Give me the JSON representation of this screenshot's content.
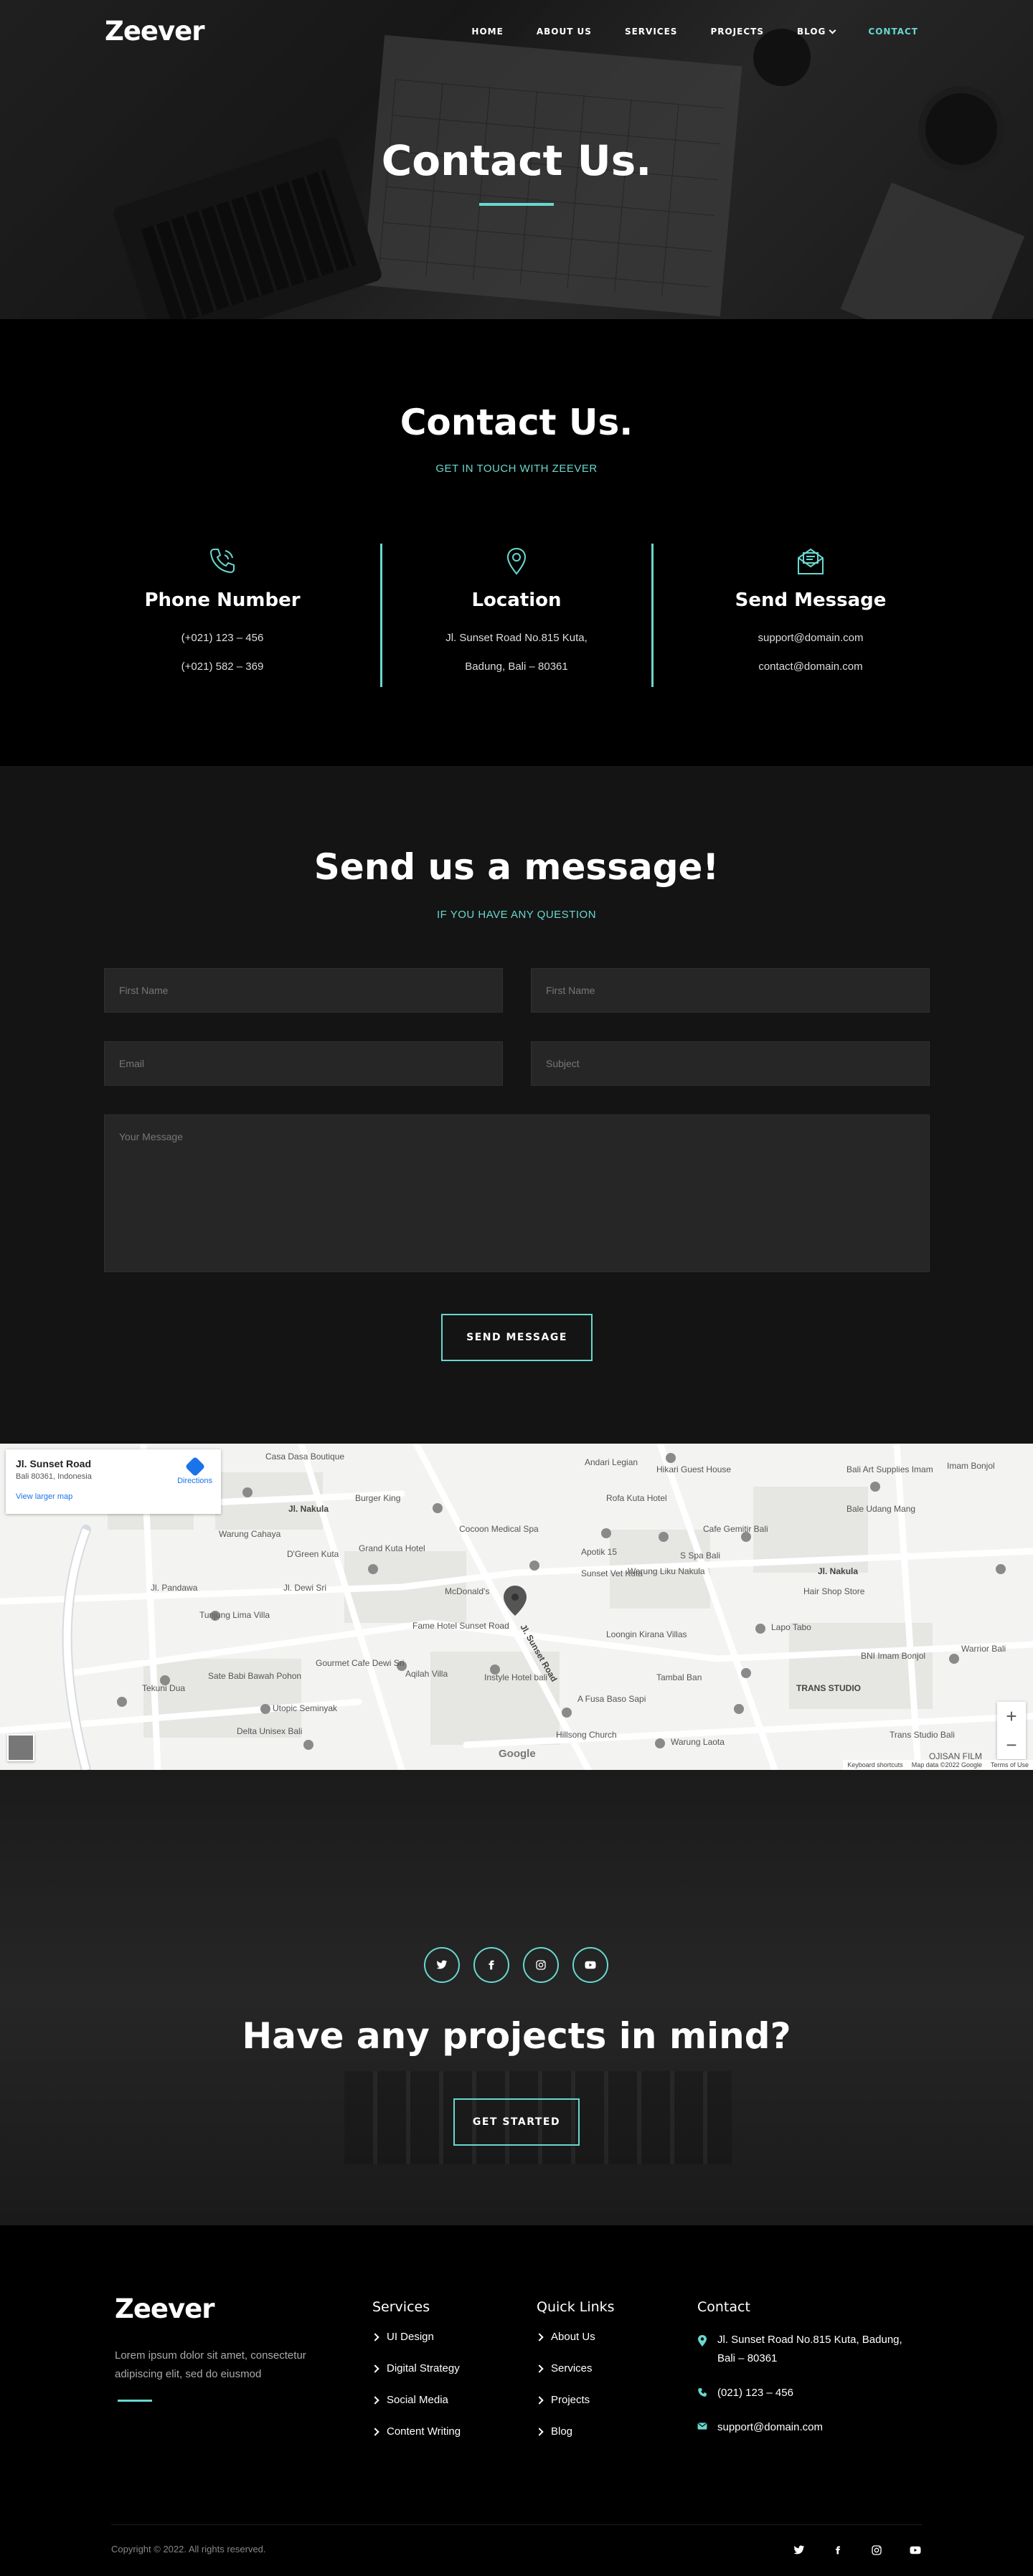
{
  "brand": {
    "logo": "Zeever",
    "accent": "#68d8cf"
  },
  "nav": {
    "items": [
      {
        "label": "HOME",
        "active": false
      },
      {
        "label": "ABOUT US",
        "active": false
      },
      {
        "label": "SERVICES",
        "active": false
      },
      {
        "label": "PROJECTS",
        "active": false
      },
      {
        "label": "BLOG",
        "active": false,
        "has_dropdown": true
      },
      {
        "label": "CONTACT",
        "active": true
      }
    ]
  },
  "hero": {
    "title": "Contact Us."
  },
  "contact_info": {
    "title": "Contact Us.",
    "subtitle": "GET IN TOUCH WITH ZEEVER",
    "columns": [
      {
        "icon": "phone-icon",
        "heading": "Phone Number",
        "lines": [
          "(+021) 123 – 456",
          "(+021) 582 – 369"
        ]
      },
      {
        "icon": "location-pin-icon",
        "heading": "Location",
        "lines": [
          "Jl. Sunset Road No.815 Kuta,",
          "Badung, Bali – 80361"
        ]
      },
      {
        "icon": "envelope-icon",
        "heading": "Send Message",
        "lines": [
          "support@domain.com",
          "contact@domain.com"
        ]
      }
    ]
  },
  "form": {
    "title": "Send us a message!",
    "subtitle": "IF YOU HAVE ANY QUESTION",
    "placeholders": {
      "first_name": "First Name",
      "last_name": "First Name",
      "email": "Email",
      "subject": "Subject",
      "message": "Your Message"
    },
    "submit_label": "SEND MESSAGE"
  },
  "map": {
    "place_title": "Jl. Sunset Road",
    "place_address": "Bali 80361, Indonesia",
    "larger_map": "View larger map",
    "directions": "Directions",
    "footer_links": [
      "Keyboard shortcuts",
      "Map data ©2022 Google",
      "Terms of Use"
    ],
    "google_label": "Google",
    "labels": [
      "Casa Dasa Boutique",
      "Andari Legian",
      "Hikari Guest House",
      "Bali Art Supplies Imam Bonjol (Bali Artemedia)",
      "Roja Kuta Hotel (ex-Hardys Rofa Hotel)",
      "Burger King Sunset Road Bali",
      "Warung Cahaya",
      "Cocoon Medical Spa",
      "Apotik 15 Chemist Nakula",
      "Cafe Gemitir Bali",
      "Bale Udang Mang Engking Kuta",
      "Imam Bonjol Beautiful Regency",
      "Grand Kuta Hotel and Residence",
      "D'Green Kuta",
      "Warung Liku Nakula",
      "S Spa Bali",
      "Jl. Nakula",
      "Hair Shop Store",
      "McDonald's Fast Food",
      "Sunset Vet Kuta",
      "Lapo Tabo",
      "Tunjung Lima Villa",
      "Fame Hotel Sunset Road",
      "Loongin Kirana Villas",
      "BNI Imam Bonjol",
      "Warrior Bali",
      "Gourmet Cafe Dewi Sri",
      "Aqilah Villa",
      "Instyle Hotel bali",
      "Tambal Ban Panggilan 24 Jam",
      "TRANS STUDIO MALL BALI",
      "Sate Babi Bawah Pohon",
      "Tekuni Dua",
      "Utopic Seminyak",
      "A Fusa Baso Sapi Asli Sunset Road",
      "Hillsong Church Bali Campus",
      "Delta Unisex Bali",
      "Warung Laota Sunset Road",
      "Trans Studio Bali",
      "OJISAN FILM",
      "Jl. Sunset Road",
      "Jl. Dewi Sri",
      "Jl. Pandawa"
    ]
  },
  "cta": {
    "social": [
      "twitter-icon",
      "facebook-icon",
      "instagram-icon",
      "youtube-icon"
    ],
    "title": "Have any projects in mind?",
    "button": "GET STARTED"
  },
  "footer": {
    "logo": "Zeever",
    "about": "Lorem ipsum dolor sit amet, consectetur adipiscing elit, sed do eiusmod",
    "services": {
      "heading": "Services",
      "items": [
        "UI Design",
        "Digital Strategy",
        "Social Media",
        "Content Writing"
      ]
    },
    "quick_links": {
      "heading": "Quick Links",
      "items": [
        "About Us",
        "Services",
        "Projects",
        "Blog"
      ]
    },
    "contact": {
      "heading": "Contact",
      "address": "Jl. Sunset Road No.815 Kuta, Badung, Bali – 80361",
      "phone": "(021) 123 – 456",
      "email": "support@domain.com"
    },
    "copyright": "Copyright © 2022. All rights reserved.",
    "social": [
      "twitter-icon",
      "facebook-icon",
      "instagram-icon",
      "youtube-icon"
    ]
  }
}
